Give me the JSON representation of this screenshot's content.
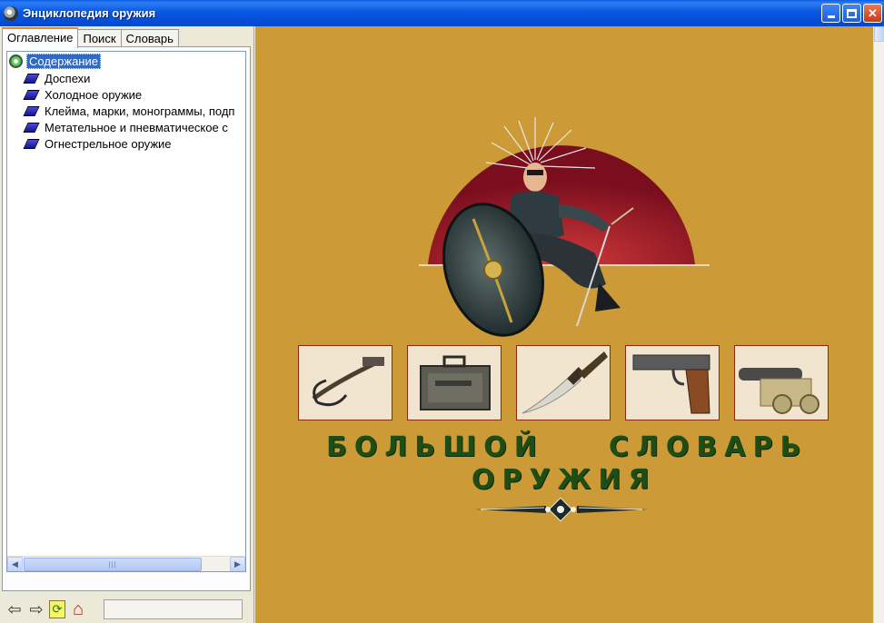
{
  "window": {
    "title": "Энциклопедия оружия",
    "controls": {
      "minimize": "minimize",
      "maximize": "maximize",
      "close": "✕"
    }
  },
  "tabs": [
    {
      "label": "Оглавление",
      "active": true
    },
    {
      "label": "Поиск",
      "active": false
    },
    {
      "label": "Словарь",
      "active": false
    }
  ],
  "tree": {
    "root": "Содержание",
    "items": [
      {
        "label": "Доспехи"
      },
      {
        "label": "Холодное оружие"
      },
      {
        "label": "Клейма, марки, монограммы, подп"
      },
      {
        "label": "Метательное и пневматическое с"
      },
      {
        "label": "Огнестрельное оружие"
      }
    ]
  },
  "toolbar": {
    "back": "⇦",
    "forward": "⇨",
    "refresh": "⟳",
    "home": "⌂"
  },
  "scrollbar": {
    "grip": "|||"
  },
  "main": {
    "title_words": [
      "БОЛЬШОЙ",
      "СЛОВАРЬ",
      "ОРУЖИЯ"
    ],
    "thumbnails": [
      {
        "subject": "crossbow"
      },
      {
        "subject": "gun-case"
      },
      {
        "subject": "knife"
      },
      {
        "subject": "pistol"
      },
      {
        "subject": "cannon"
      }
    ]
  },
  "colors": {
    "content_bg": "#cc9a36",
    "title_green": "#1e4d15",
    "hero_arc": "#9b1a2a",
    "thumb_border": "#8a2a10",
    "selection": "#316ac5"
  }
}
